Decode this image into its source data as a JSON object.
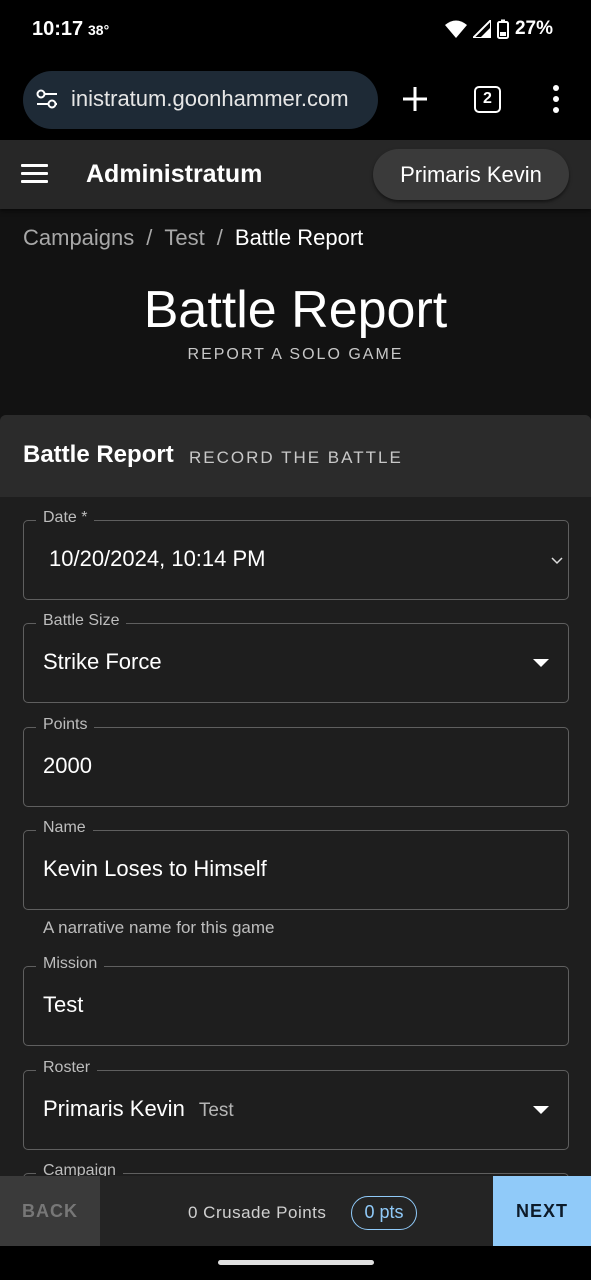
{
  "status": {
    "time": "10:17",
    "temp": "38°",
    "battery": "27%"
  },
  "browser": {
    "url": "inistratum.goonhammer.com",
    "tab_count": "2"
  },
  "app": {
    "title": "Administratum",
    "user": "Primaris Kevin"
  },
  "breadcrumb": {
    "items": [
      "Campaigns",
      "Test"
    ],
    "current": "Battle Report"
  },
  "page": {
    "title": "Battle Report",
    "subtitle": "REPORT A SOLO GAME"
  },
  "card": {
    "title": "Battle Report",
    "subtitle": "RECORD THE BATTLE"
  },
  "form": {
    "date": {
      "label": "Date *",
      "value": "10/20/2024, 10:14 PM"
    },
    "battle_size": {
      "label": "Battle Size",
      "value": "Strike Force"
    },
    "points": {
      "label": "Points",
      "value": "2000"
    },
    "name": {
      "label": "Name",
      "value": "Kevin Loses to Himself",
      "helper": "A narrative name for this game"
    },
    "mission": {
      "label": "Mission",
      "value": "Test"
    },
    "roster": {
      "label": "Roster",
      "value": "Primaris Kevin",
      "secondary": "Test"
    },
    "campaign": {
      "label": "Campaign"
    }
  },
  "footer": {
    "back_label": "BACK",
    "crusade_points": "0 Crusade Points",
    "pts": "0 pts",
    "next_label": "NEXT"
  }
}
